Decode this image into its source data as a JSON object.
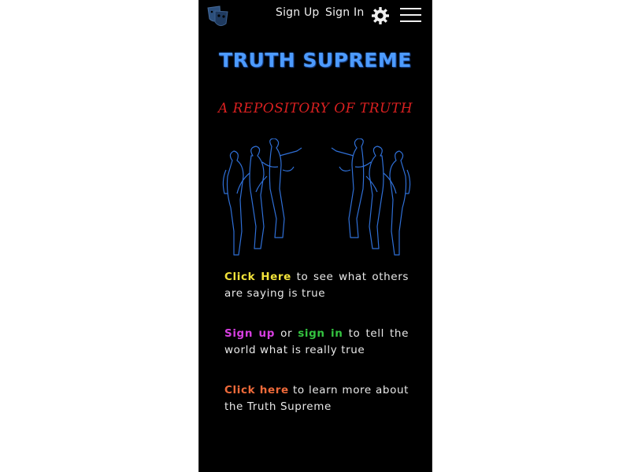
{
  "header": {
    "signup_label": "Sign Up",
    "signin_label": "Sign In",
    "logo_icon": "masks-logo-icon",
    "settings_icon": "gear-icon",
    "menu_icon": "hamburger-menu-icon"
  },
  "hero": {
    "title": "TRUTH SUPREME",
    "tagline": "A REPOSITORY OF TRUTH",
    "image": "crowd-silhouettes-illustration"
  },
  "content": {
    "para1": {
      "link": "Click Here",
      "text": " to see what others are saying is true"
    },
    "para2": {
      "link_signup": "Sign up",
      "or": " or ",
      "link_signin": "sign in",
      "text": " to tell the world what is really true"
    },
    "para3": {
      "link": "Click here",
      "text": " to learn more about the Truth Supreme"
    }
  },
  "colors": {
    "background": "#000000",
    "title": "#4d9bff",
    "tagline": "#d92020",
    "link_yellow": "#f2e23a",
    "link_magenta": "#d63ee0",
    "link_green": "#34c440",
    "link_orange": "#ef6a3a"
  }
}
